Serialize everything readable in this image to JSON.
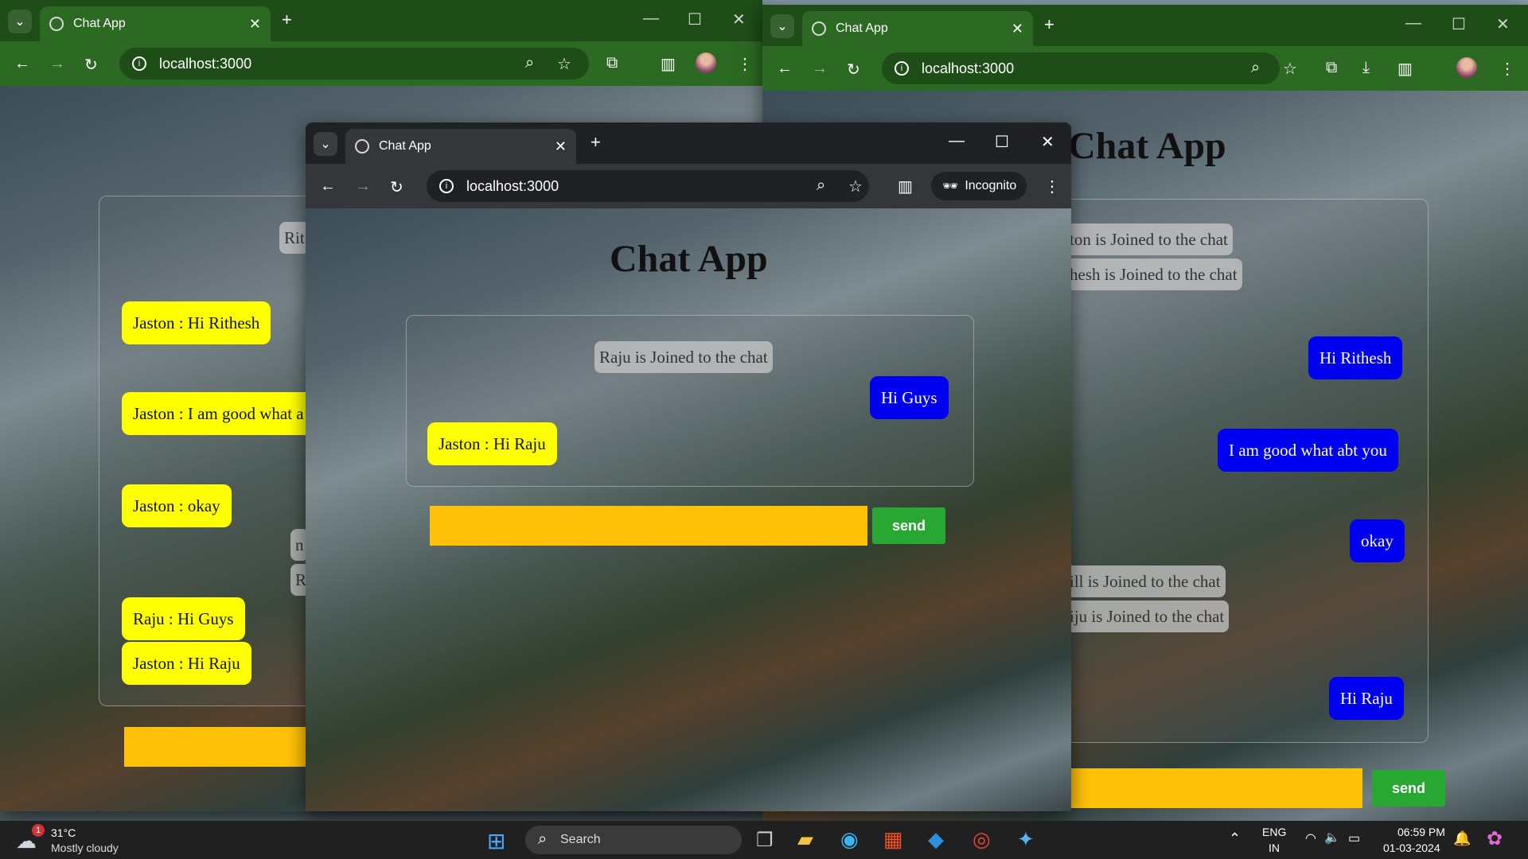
{
  "browser": {
    "tab_title": "Chat App",
    "url": "localhost:3000",
    "incognito_label": "Incognito",
    "new_tab": "+",
    "close_tab": "✕"
  },
  "chat": {
    "title": "Chat App",
    "send_label": "send"
  },
  "left_window": {
    "messages": [
      {
        "text": "Rit",
        "kind": "sys"
      },
      {
        "text": "Jaston : Hi Rithesh",
        "kind": "recv"
      },
      {
        "text": "Jaston : I am good what a",
        "kind": "recv"
      },
      {
        "text": "Jaston : okay",
        "kind": "recv"
      },
      {
        "text": "n",
        "kind": "sys"
      },
      {
        "text": "R",
        "kind": "sys"
      },
      {
        "text": "Raju : Hi Guys",
        "kind": "recv"
      },
      {
        "text": "Jaston : Hi Raju",
        "kind": "recv"
      }
    ]
  },
  "center_window": {
    "messages": [
      {
        "text": "Raju is Joined to the chat",
        "kind": "sys"
      },
      {
        "text": "Hi Guys",
        "kind": "sent"
      },
      {
        "text": "Jaston : Hi Raju",
        "kind": "recv"
      }
    ]
  },
  "right_window": {
    "title": "Chat App",
    "messages": [
      {
        "text": "ton is Joined to the chat",
        "kind": "sys"
      },
      {
        "text": "hesh is Joined to the chat",
        "kind": "sys"
      },
      {
        "text": "Hi Rithesh",
        "kind": "sent"
      },
      {
        "text": "I am good what abt you",
        "kind": "sent"
      },
      {
        "text": "okay",
        "kind": "sent"
      },
      {
        "text": "ill is Joined to the chat",
        "kind": "sys"
      },
      {
        "text": "iju is Joined to the chat",
        "kind": "sys"
      },
      {
        "text": "Hi Raju",
        "kind": "sent"
      }
    ]
  },
  "taskbar": {
    "weather_temp": "31°C",
    "weather_desc": "Mostly cloudy",
    "weather_badge": "1",
    "search_label": "Search",
    "lang_top": "ENG",
    "lang_bottom": "IN",
    "time": "06:59 PM",
    "date": "01-03-2024"
  }
}
